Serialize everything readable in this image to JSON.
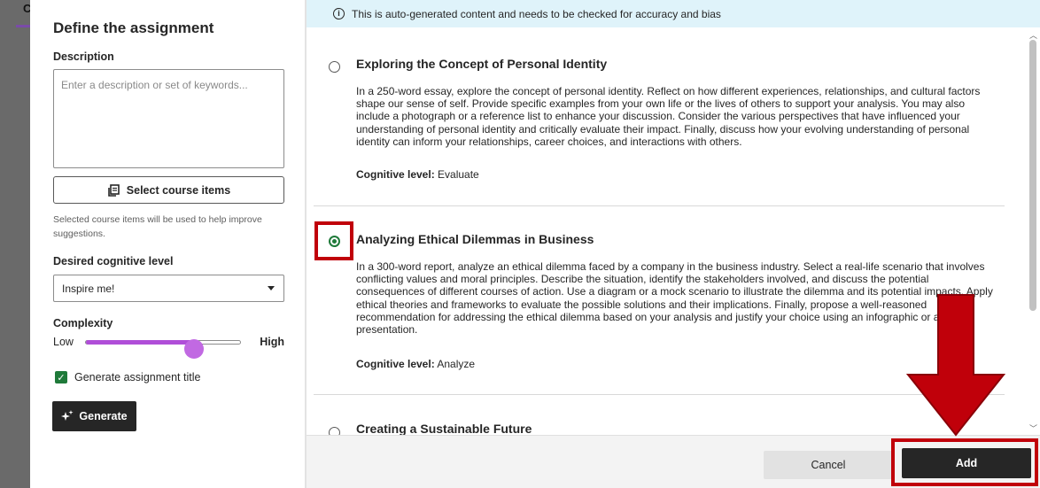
{
  "background": {
    "letter": "C"
  },
  "panel": {
    "title": "Define the assignment",
    "description_label": "Description",
    "description_placeholder": "Enter a description or set of keywords...",
    "select_items_label": "Select course items",
    "select_items_hint": "Selected course items will be used to help improve suggestions.",
    "cognitive_label": "Desired cognitive level",
    "cognitive_value": "Inspire me!",
    "complexity_label": "Complexity",
    "complexity_low": "Low",
    "complexity_high": "High",
    "complexity_value_fraction": 0.7,
    "generate_title_label": "Generate assignment title",
    "generate_title_checked": true,
    "generate_button": "Generate"
  },
  "banner": {
    "text": "This is auto-generated content and needs to be checked for accuracy and bias"
  },
  "suggestions": [
    {
      "title": "Exploring the Concept of Personal Identity",
      "body": "In a 250-word essay, explore the concept of personal identity. Reflect on how different experiences, relationships, and cultural factors shape our sense of self. Provide specific examples from your own life or the lives of others to support your analysis. You may also include a photograph or a reference list to enhance your discussion. Consider the various perspectives that have influenced your understanding of personal identity and critically evaluate their impact. Finally, discuss how your evolving understanding of personal identity can inform your relationships, career choices, and interactions with others.",
      "cognitive_prefix": "Cognitive level:",
      "cognitive_value": "Evaluate",
      "selected": false
    },
    {
      "title": "Analyzing Ethical Dilemmas in Business",
      "body": "In a 300-word report, analyze an ethical dilemma faced by a company in the business industry. Select a real-life scenario that involves conflicting values and moral principles. Describe the situation, identify the stakeholders involved, and discuss the potential consequences of different courses of action. Use a diagram or a mock scenario to illustrate the dilemma and its potential impacts. Apply ethical theories and frameworks to evaluate the possible solutions and their implications. Finally, propose a well-reasoned recommendation for addressing the ethical dilemma based on your analysis and justify your choice using an infographic or a presentation.",
      "cognitive_prefix": "Cognitive level:",
      "cognitive_value": "Analyze",
      "selected": true
    },
    {
      "title": "Creating a Sustainable Future",
      "selected": false
    }
  ],
  "footer": {
    "cancel": "Cancel",
    "add": "Add"
  },
  "colors": {
    "highlight": "#c0000a",
    "accent_green": "#1f7a3a",
    "slider": "#b04ed8"
  }
}
